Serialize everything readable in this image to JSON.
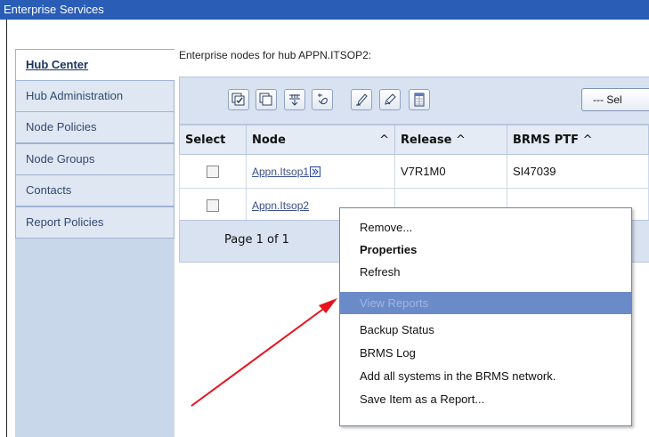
{
  "window": {
    "title": "Enterprise Services"
  },
  "sidebar": {
    "items": [
      {
        "label": "Hub Center",
        "active": true
      },
      {
        "label": "Hub Administration"
      },
      {
        "label": "Node Policies"
      },
      {
        "label": "Node Groups"
      },
      {
        "label": "Contacts"
      },
      {
        "label": "Report Policies"
      }
    ]
  },
  "main": {
    "title": "Enterprise nodes for hub APPN.ITSOP2:",
    "toolbar": {
      "buttons": [
        "select-all-icon",
        "deselect-all-icon",
        "expand-icon",
        "filter-icon",
        "edit-sort-icon",
        "clear-sort-icon",
        "table-icon"
      ],
      "select_action": "--- Sel"
    },
    "table": {
      "columns": [
        "Select",
        "Node",
        "Release",
        "BRMS PTF"
      ],
      "sort_glyph": "^",
      "rows": [
        {
          "node": "Appn.Itsop1",
          "release": "V7R1M0",
          "ptf": "SI47039"
        },
        {
          "node": "Appn.Itsop2",
          "release": "",
          "ptf": ""
        }
      ]
    },
    "pager": {
      "text": "Page 1 of 1"
    }
  },
  "context_menu": {
    "items": [
      {
        "label": "Remove..."
      },
      {
        "label": "Properties",
        "bold": true
      },
      {
        "label": "Refresh"
      },
      {
        "label": "View Reports",
        "highlighted": true
      },
      {
        "label": "Backup Status"
      },
      {
        "label": "BRMS Log"
      },
      {
        "label": "Add all systems in the BRMS network."
      },
      {
        "label": "Save Item as a Report..."
      }
    ]
  },
  "colors": {
    "titlebar": "#2a5db6",
    "sidebar": "#c9d7ea",
    "highlight": "#6b8bc8",
    "arrow": "#e8121e"
  }
}
